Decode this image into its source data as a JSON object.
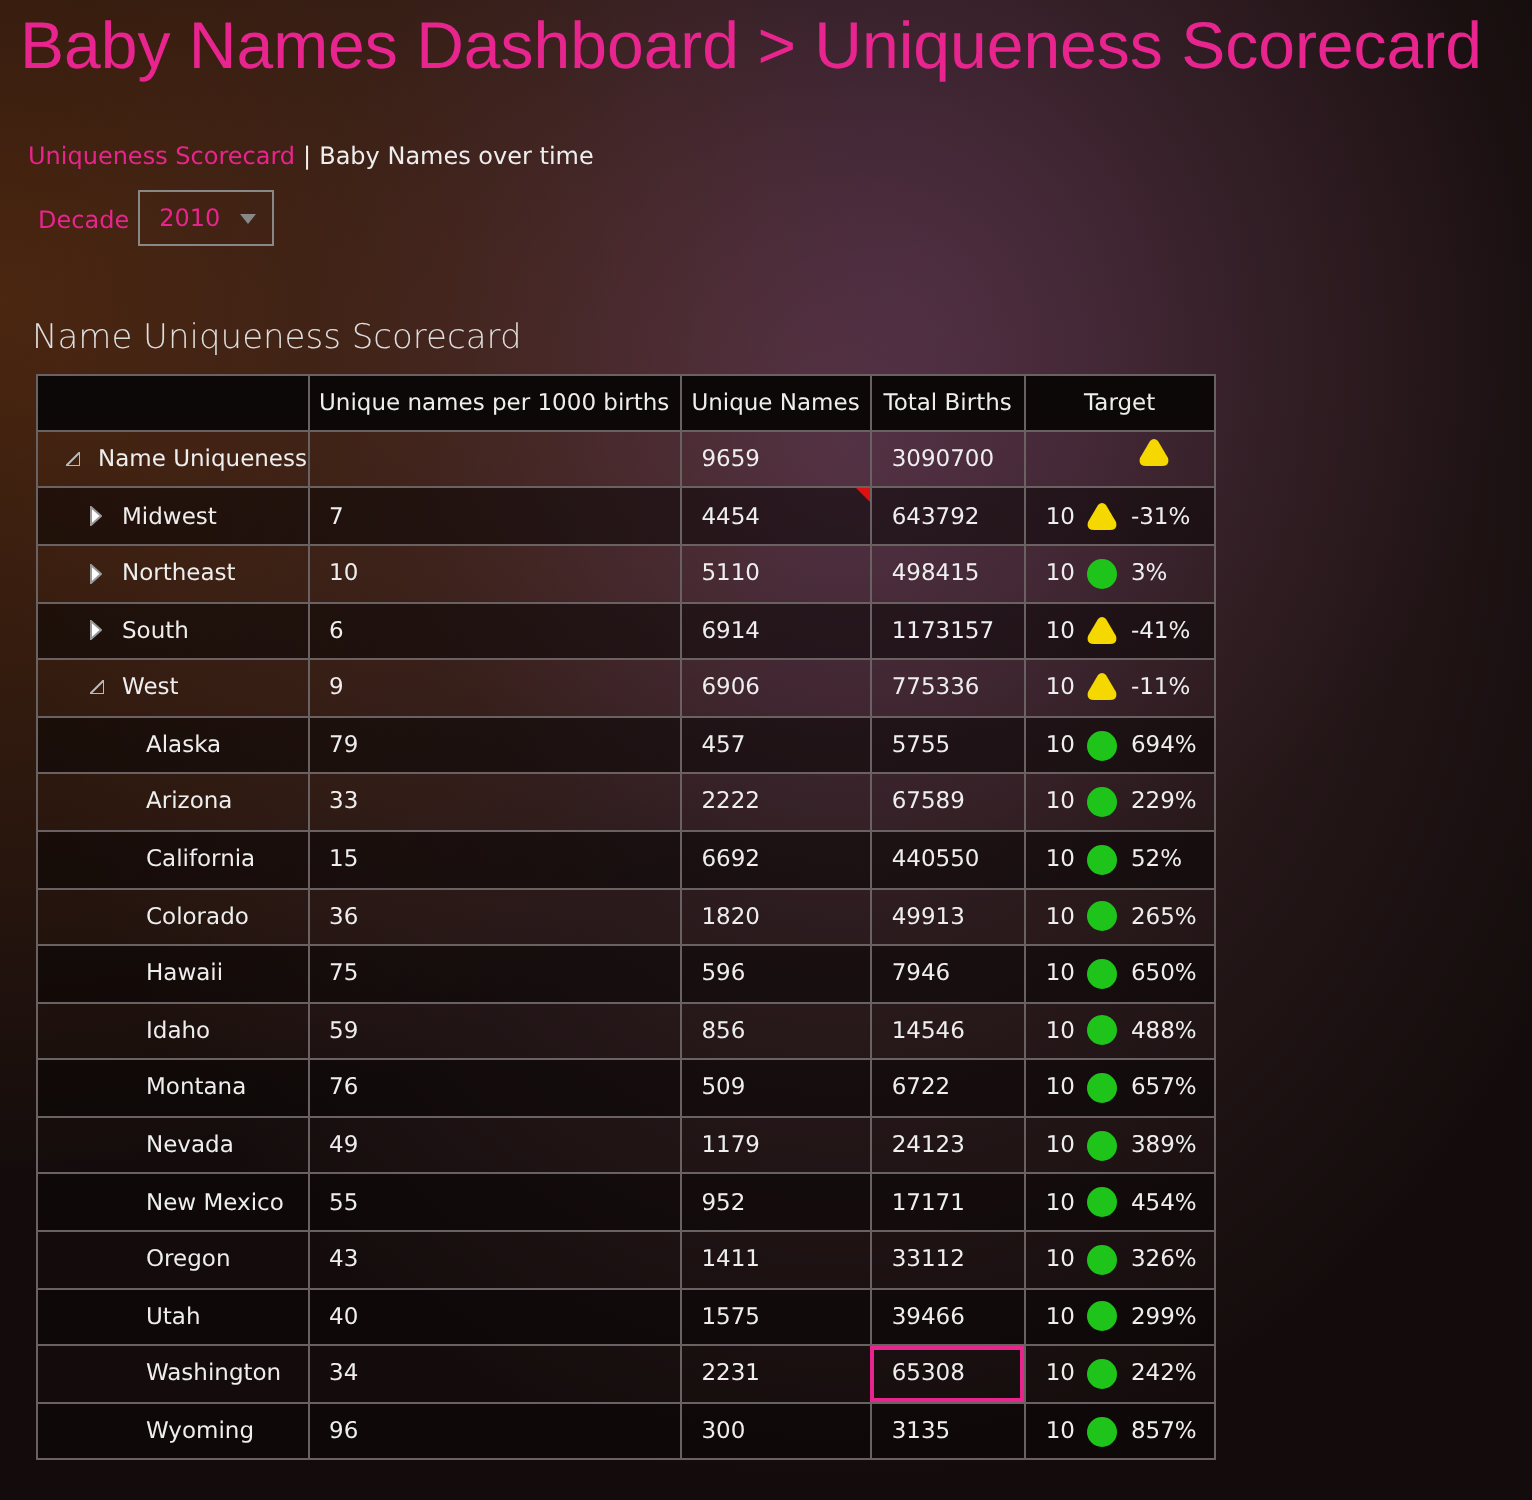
{
  "title": "Baby Names Dashboard > Uniqueness Scorecard",
  "nav": [
    {
      "label": "Uniqueness Scorecard",
      "selected": true
    },
    {
      "label": "Baby Names over time",
      "selected": false
    }
  ],
  "nav_separator": "|",
  "decade": {
    "label": "Decade",
    "value": "2010"
  },
  "scorecard": {
    "title": "Name Uniqueness Scorecard",
    "columns": [
      "Unique names per 1000 births",
      "Unique Names",
      "Total Births",
      "Target"
    ],
    "rows": [
      {
        "name": "Name Uniqueness",
        "expanded": true,
        "unique": "9659",
        "births": "3090700",
        "kind": "triangle",
        "color": "#f5d800",
        "flagged": false,
        "selected": false,
        "children": [
          {
            "name": "Midwest",
            "expanded": false,
            "per1000": "7",
            "unique": "4454",
            "births": "643792",
            "target": "10",
            "kind": "triangle",
            "color": "#f5d800",
            "pct": "-31%",
            "flagged": true,
            "selected": false
          },
          {
            "name": "Northeast",
            "expanded": false,
            "per1000": "10",
            "unique": "5110",
            "births": "498415",
            "target": "10",
            "kind": "circle",
            "color": "#1fc41a",
            "pct": "3%",
            "flagged": false,
            "selected": false
          },
          {
            "name": "South",
            "expanded": false,
            "per1000": "6",
            "unique": "6914",
            "births": "1173157",
            "target": "10",
            "kind": "triangle",
            "color": "#f5d800",
            "pct": "-41%",
            "flagged": false,
            "selected": false
          },
          {
            "name": "West",
            "expanded": true,
            "per1000": "9",
            "unique": "6906",
            "births": "775336",
            "target": "10",
            "kind": "triangle",
            "color": "#f5d800",
            "pct": "-11%",
            "flagged": false,
            "selected": false,
            "children": [
              {
                "name": "Alaska",
                "per1000": "79",
                "unique": "457",
                "births": "5755",
                "target": "10",
                "kind": "circle",
                "color": "#1fc41a",
                "pct": "694%",
                "flagged": false,
                "selected": false
              },
              {
                "name": "Arizona",
                "per1000": "33",
                "unique": "2222",
                "births": "67589",
                "target": "10",
                "kind": "circle",
                "color": "#1fc41a",
                "pct": "229%",
                "flagged": false,
                "selected": false
              },
              {
                "name": "California",
                "per1000": "15",
                "unique": "6692",
                "births": "440550",
                "target": "10",
                "kind": "circle",
                "color": "#1fc41a",
                "pct": "52%",
                "flagged": false,
                "selected": false
              },
              {
                "name": "Colorado",
                "per1000": "36",
                "unique": "1820",
                "births": "49913",
                "target": "10",
                "kind": "circle",
                "color": "#1fc41a",
                "pct": "265%",
                "flagged": false,
                "selected": false
              },
              {
                "name": "Hawaii",
                "per1000": "75",
                "unique": "596",
                "births": "7946",
                "target": "10",
                "kind": "circle",
                "color": "#1fc41a",
                "pct": "650%",
                "flagged": false,
                "selected": false
              },
              {
                "name": "Idaho",
                "per1000": "59",
                "unique": "856",
                "births": "14546",
                "target": "10",
                "kind": "circle",
                "color": "#1fc41a",
                "pct": "488%",
                "flagged": false,
                "selected": false
              },
              {
                "name": "Montana",
                "per1000": "76",
                "unique": "509",
                "births": "6722",
                "target": "10",
                "kind": "circle",
                "color": "#1fc41a",
                "pct": "657%",
                "flagged": false,
                "selected": false
              },
              {
                "name": "Nevada",
                "per1000": "49",
                "unique": "1179",
                "births": "24123",
                "target": "10",
                "kind": "circle",
                "color": "#1fc41a",
                "pct": "389%",
                "flagged": false,
                "selected": false
              },
              {
                "name": "New Mexico",
                "per1000": "55",
                "unique": "952",
                "births": "17171",
                "target": "10",
                "kind": "circle",
                "color": "#1fc41a",
                "pct": "454%",
                "flagged": false,
                "selected": false
              },
              {
                "name": "Oregon",
                "per1000": "43",
                "unique": "1411",
                "births": "33112",
                "target": "10",
                "kind": "circle",
                "color": "#1fc41a",
                "pct": "326%",
                "flagged": false,
                "selected": false
              },
              {
                "name": "Utah",
                "per1000": "40",
                "unique": "1575",
                "births": "39466",
                "target": "10",
                "kind": "circle",
                "color": "#1fc41a",
                "pct": "299%",
                "flagged": false,
                "selected": false
              },
              {
                "name": "Washington",
                "per1000": "34",
                "unique": "2231",
                "births": "65308",
                "target": "10",
                "kind": "circle",
                "color": "#1fc41a",
                "pct": "242%",
                "flagged": false,
                "selected": true
              },
              {
                "name": "Wyoming",
                "per1000": "96",
                "unique": "300",
                "births": "3135",
                "target": "10",
                "kind": "circle",
                "color": "#1fc41a",
                "pct": "857%",
                "flagged": false,
                "selected": false
              }
            ]
          }
        ]
      }
    ]
  }
}
